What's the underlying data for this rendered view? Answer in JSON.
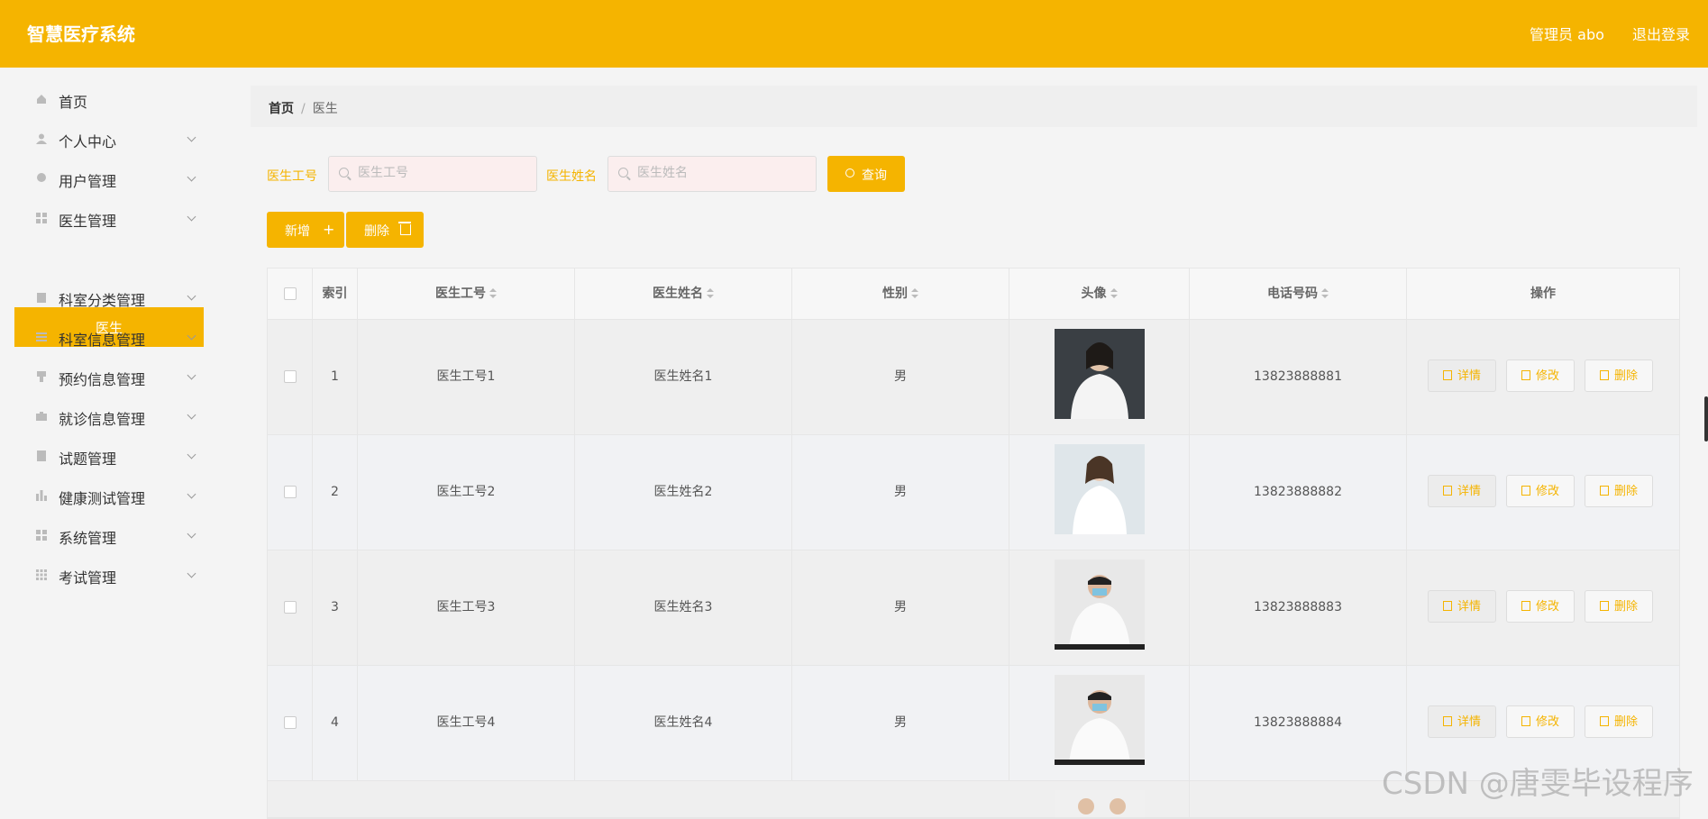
{
  "app": {
    "title": "智慧医疗系统"
  },
  "header": {
    "user": "管理员 abo",
    "logout": "退出登录"
  },
  "sidebar": {
    "items": [
      {
        "label": "首页",
        "icon": "home-icon"
      },
      {
        "label": "个人中心",
        "icon": "user-icon"
      },
      {
        "label": "用户管理",
        "icon": "users-icon"
      },
      {
        "label": "医生管理",
        "icon": "grid-icon"
      },
      {
        "label": "科室分类管理",
        "icon": "clipboard-icon"
      },
      {
        "label": "科室信息管理",
        "icon": "list-icon"
      },
      {
        "label": "预约信息管理",
        "icon": "bookmark-icon"
      },
      {
        "label": "就诊信息管理",
        "icon": "briefcase-icon"
      },
      {
        "label": "试题管理",
        "icon": "file-icon"
      },
      {
        "label": "健康测试管理",
        "icon": "chart-icon"
      },
      {
        "label": "系统管理",
        "icon": "grid-icon"
      },
      {
        "label": "考试管理",
        "icon": "apps-icon"
      }
    ],
    "active_sub": "医生"
  },
  "breadcrumb": {
    "home": "首页",
    "current": "医生"
  },
  "search": {
    "id_label": "医生工号",
    "id_placeholder": "医生工号",
    "name_label": "医生姓名",
    "name_placeholder": "医生姓名",
    "query": "查询"
  },
  "toolbar": {
    "add": "新增",
    "delete": "删除"
  },
  "table": {
    "headers": {
      "index": "索引",
      "id": "医生工号",
      "name": "医生姓名",
      "gender": "性别",
      "avatar": "头像",
      "phone": "电话号码",
      "ops": "操作"
    },
    "actions": {
      "detail": "详情",
      "edit": "修改",
      "delete": "删除"
    },
    "rows": [
      {
        "index": "1",
        "id": "医生工号1",
        "name": "医生姓名1",
        "gender": "男",
        "phone": "13823888881"
      },
      {
        "index": "2",
        "id": "医生工号2",
        "name": "医生姓名2",
        "gender": "男",
        "phone": "13823888882"
      },
      {
        "index": "3",
        "id": "医生工号3",
        "name": "医生姓名3",
        "gender": "男",
        "phone": "13823888883"
      },
      {
        "index": "4",
        "id": "医生工号4",
        "name": "医生姓名4",
        "gender": "男",
        "phone": "13823888884"
      }
    ]
  },
  "watermark": "CSDN @唐雯毕设程序",
  "colors": {
    "accent": "#f5b400"
  }
}
